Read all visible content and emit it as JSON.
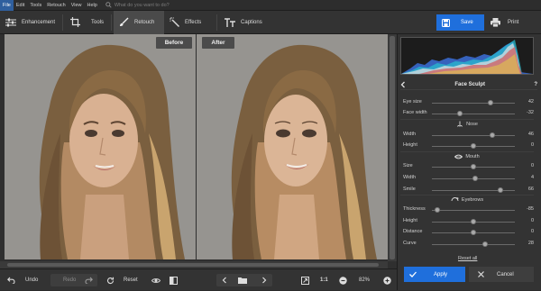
{
  "menu": {
    "items": [
      "File",
      "Edit",
      "Tools",
      "Retouch",
      "View",
      "Help"
    ],
    "search_placeholder": "What do you want to do?"
  },
  "toolbar": {
    "enhancement": "Enhancement",
    "tools": "Tools",
    "retouch": "Retouch",
    "effects": "Effects",
    "captions": "Captions",
    "save": "Save",
    "print": "Print"
  },
  "compare": {
    "before": "Before",
    "after": "After"
  },
  "bottom": {
    "undo": "Undo",
    "redo": "Redo",
    "reset": "Reset",
    "zoom_fit": "1:1",
    "zoom": "82%"
  },
  "panel": {
    "title": "Face Sculpt",
    "face": [
      {
        "label": "Eye size",
        "value": "42",
        "level": 0.71
      },
      {
        "label": "Face width",
        "value": "-32",
        "level": 0.34
      }
    ],
    "nose_title": "Nose",
    "nose": [
      {
        "label": "Width",
        "value": "46",
        "level": 0.73
      },
      {
        "label": "Height",
        "value": "0",
        "level": 0.5
      }
    ],
    "mouth_title": "Mouth",
    "mouth": [
      {
        "label": "Size",
        "value": "0",
        "level": 0.5
      },
      {
        "label": "Width",
        "value": "4",
        "level": 0.52
      },
      {
        "label": "Smile",
        "value": "66",
        "level": 0.83
      }
    ],
    "eyebrows_title": "Eyebrows",
    "eyebrows": [
      {
        "label": "Thickness",
        "value": "-85",
        "level": 0.07
      },
      {
        "label": "Height",
        "value": "0",
        "level": 0.5
      },
      {
        "label": "Distance",
        "value": "0",
        "level": 0.5
      },
      {
        "label": "Curve",
        "value": "28",
        "level": 0.64
      }
    ],
    "reset_all": "Reset all",
    "apply": "Apply",
    "cancel": "Cancel"
  },
  "colors": {
    "accent": "#1f6fdc",
    "background": "#2b2b2b"
  }
}
